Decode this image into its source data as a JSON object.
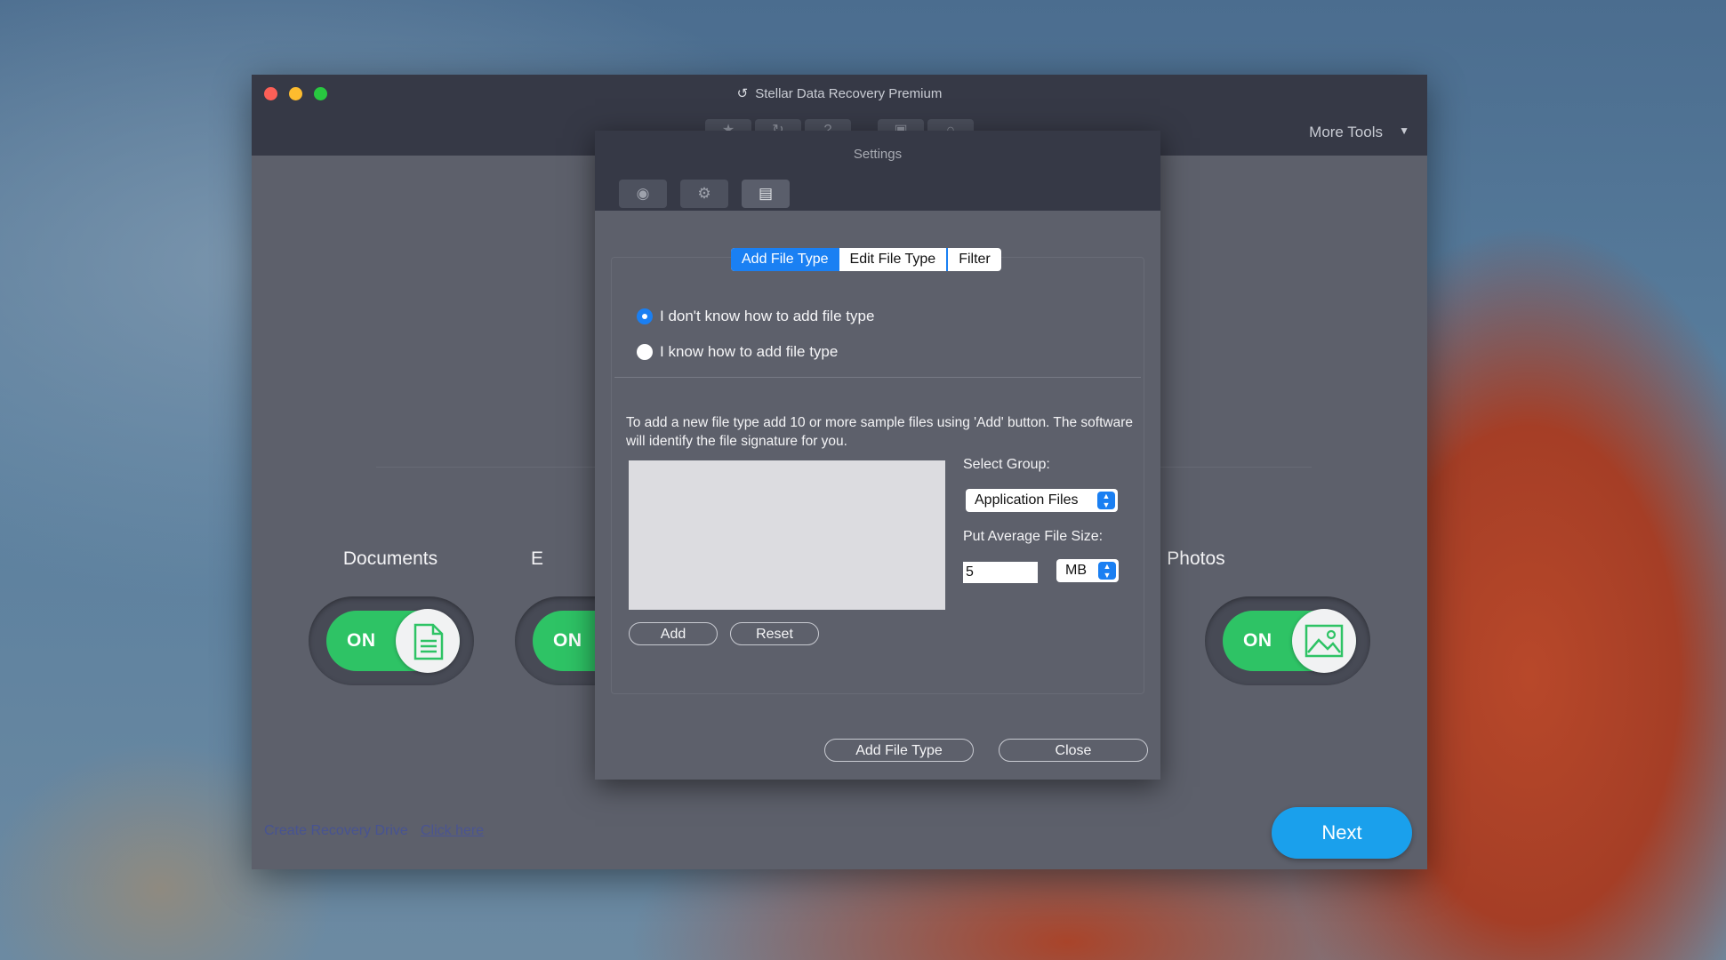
{
  "window": {
    "title": "Stellar Data Recovery Premium",
    "title_icon": "back-arrow-icon",
    "more_tools": "More Tools"
  },
  "categories": [
    {
      "label": "Documents",
      "toggle": "ON",
      "icon": "document-icon"
    },
    {
      "label": "E",
      "toggle": "ON",
      "icon": "email-icon"
    },
    {
      "label": "Photos",
      "toggle": "ON",
      "icon": "photo-icon"
    }
  ],
  "footer": {
    "create_drive": "Create Recovery Drive",
    "click_here": "Click here",
    "next": "Next"
  },
  "settings": {
    "title": "Settings",
    "tabs": [
      "eye-icon",
      "gear-icon",
      "file-icon"
    ],
    "segments": [
      "Add File Type",
      "Edit File Type",
      "Filter"
    ],
    "selected_segment": "Add File Type",
    "radio_options": [
      "I don't know how to add file type",
      "I know how to add file type"
    ],
    "selected_radio": 0,
    "description": "To add a new file type add 10 or more sample files using 'Add' button. The software will identify the file signature for you.",
    "select_group_label": "Select Group:",
    "select_group_value": "Application Files",
    "avg_size_label": "Put Average File Size:",
    "avg_size_value": "5",
    "avg_size_unit": "MB",
    "add_button": "Add",
    "reset_button": "Reset",
    "add_file_type_button": "Add File Type",
    "close_button": "Close"
  },
  "colors": {
    "accent": "#1a80f3",
    "toggle_on": "#2ec365",
    "next_button": "#1aa0ec"
  }
}
